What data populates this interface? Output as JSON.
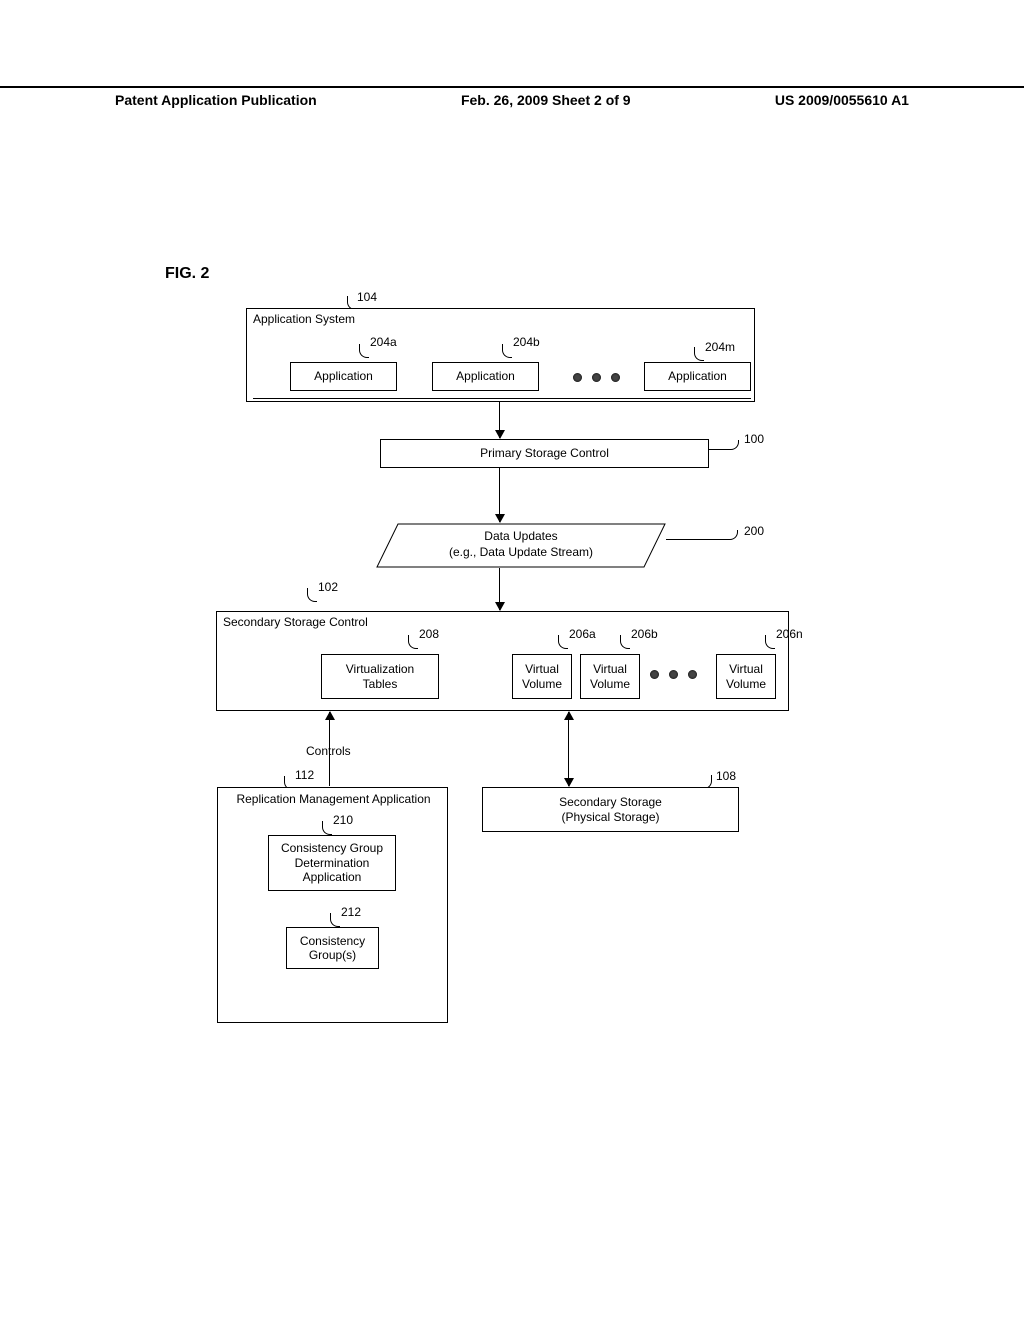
{
  "header": {
    "left": "Patent Application Publication",
    "center": "Feb. 26, 2009  Sheet 2 of 9",
    "right": "US 2009/0055610 A1"
  },
  "figure_title": "FIG. 2",
  "refs": {
    "r104": "104",
    "r204a": "204a",
    "r204b": "204b",
    "r204m": "204m",
    "r100": "100",
    "r200": "200",
    "r102": "102",
    "r208": "208",
    "r206a": "206a",
    "r206b": "206b",
    "r206n": "206n",
    "r112": "112",
    "r108": "108",
    "r210": "210",
    "r212": "212"
  },
  "app_system": {
    "title": "Application System",
    "app1": "Application",
    "app2": "Application",
    "app3": "Application"
  },
  "primary_storage": "Primary Storage Control",
  "data_updates": {
    "line1": "Data Updates",
    "line2": "(e.g., Data Update Stream)"
  },
  "secondary_ctrl": {
    "title": "Secondary Storage Control",
    "virt_tables": "Virtualization\nTables",
    "vv1": "Virtual\nVolume",
    "vv2": "Virtual\nVolume",
    "vv3": "Virtual\nVolume"
  },
  "controls_label": "Controls",
  "repl_mgmt": {
    "title": "Replication Management Application",
    "cgda": "Consistency Group\nDetermination\nApplication",
    "cg": "Consistency\nGroup(s)"
  },
  "secondary_storage": "Secondary Storage\n(Physical Storage)"
}
